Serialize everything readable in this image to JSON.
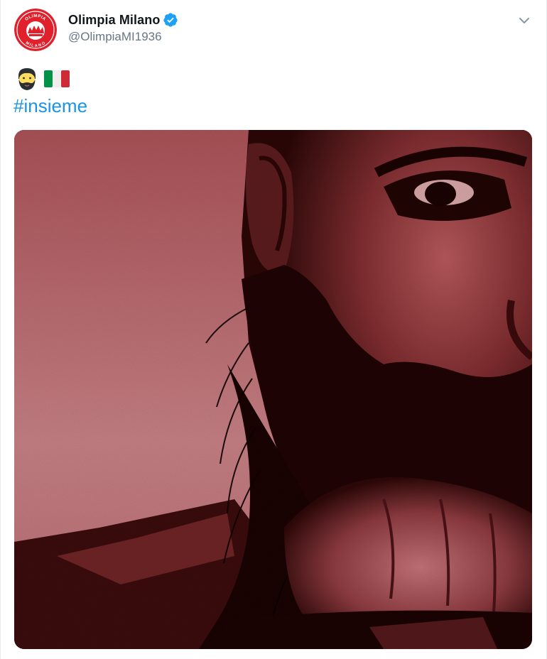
{
  "tweet": {
    "author": {
      "display_name": "Olimpia Milano",
      "handle": "@OlimpiaMI1936",
      "avatar_text_top": "OLIMPIA",
      "avatar_text_bottom": "MILANO",
      "avatar_color": "#e0202a",
      "verified": true
    },
    "emoji": [
      "bearded-man-emoji",
      "italy-flag-emoji"
    ],
    "hashtag": "#insieme",
    "media": {
      "tint_color": "#b35a5e"
    }
  },
  "colors": {
    "link": "#1b95e0",
    "name": "#14171a",
    "handle": "#657786",
    "verified": "#1da1f2"
  },
  "icons": {
    "verified": "verified-badge-icon",
    "menu": "chevron-down-icon"
  }
}
